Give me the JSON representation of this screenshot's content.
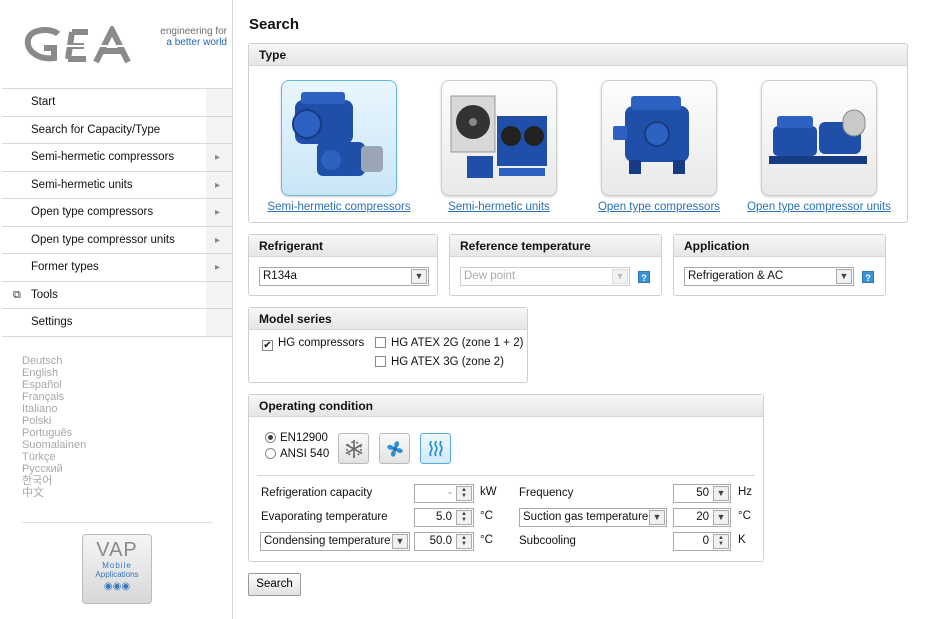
{
  "brand": {
    "logo_text": "GEA",
    "tagline_1": "engineering for",
    "tagline_2": "a better world"
  },
  "nav": [
    {
      "label": "Start",
      "has_arrow": false
    },
    {
      "label": "Search for Capacity/Type",
      "has_arrow": false
    },
    {
      "label": "Semi-hermetic compressors",
      "has_arrow": true
    },
    {
      "label": "Semi-hermetic units",
      "has_arrow": true
    },
    {
      "label": "Open type compressors",
      "has_arrow": true
    },
    {
      "label": "Open type compressor units",
      "has_arrow": true
    },
    {
      "label": "Former types",
      "has_arrow": true
    },
    {
      "label": "Tools",
      "has_arrow": false,
      "external_icon": "external-link-icon"
    },
    {
      "label": "Settings",
      "has_arrow": false
    }
  ],
  "languages": [
    "Deutsch",
    "English",
    "Español",
    "Français",
    "Italiano",
    "Polski",
    "Português",
    "Suomalainen",
    "Türkçe",
    "Русский",
    "한국어",
    "中文"
  ],
  "vap": {
    "title": "VAP",
    "line1": "Mobile",
    "line2": "Applications"
  },
  "page": {
    "title": "Search"
  },
  "type_panel": {
    "title": "Type",
    "items": [
      {
        "label": "Semi-hermetic compressors",
        "selected": true
      },
      {
        "label": "Semi-hermetic units",
        "selected": false
      },
      {
        "label": "Open type compressors",
        "selected": false
      },
      {
        "label": "Open type compressor units",
        "selected": false
      }
    ]
  },
  "refrigerant": {
    "title": "Refrigerant",
    "value": "R134a"
  },
  "reference_temperature": {
    "title": "Reference temperature",
    "value": "Dew point",
    "disabled": true
  },
  "application": {
    "title": "Application",
    "value": "Refrigeration & AC"
  },
  "model_series": {
    "title": "Model series",
    "options": [
      {
        "label": "HG compressors",
        "checked": true
      },
      {
        "label": "HG ATEX 2G (zone 1 + 2)",
        "checked": false
      },
      {
        "label": "HG ATEX 3G (zone 2)",
        "checked": false
      }
    ]
  },
  "operating_condition": {
    "title": "Operating condition",
    "standards": [
      {
        "label": "EN12900",
        "selected": true
      },
      {
        "label": "ANSI 540",
        "selected": false
      }
    ],
    "modes": [
      "snowflake-icon",
      "fan-icon",
      "heat-icon"
    ],
    "active_mode": "heat-icon",
    "fields": {
      "refrigeration_capacity": {
        "label": "Refrigeration capacity",
        "value": "-",
        "unit": "kW"
      },
      "evaporating_temperature": {
        "label": "Evaporating temperature",
        "value": "5.0",
        "unit": "°C"
      },
      "condensing_temperature": {
        "label": "Condensing temperature",
        "value": "50.0",
        "unit": "°C"
      },
      "frequency": {
        "label": "Frequency",
        "value": "50",
        "unit": "Hz"
      },
      "suction_gas_temperature": {
        "label": "Suction gas temperature",
        "value": "20",
        "unit": "°C"
      },
      "subcooling": {
        "label": "Subcooling",
        "value": "0",
        "unit": "K"
      }
    }
  },
  "search_button": {
    "label": "Search"
  },
  "colors": {
    "accent": "#2a70b8",
    "help_icon": "#3a95d8",
    "compressor_blue": "#1f4fa8"
  }
}
